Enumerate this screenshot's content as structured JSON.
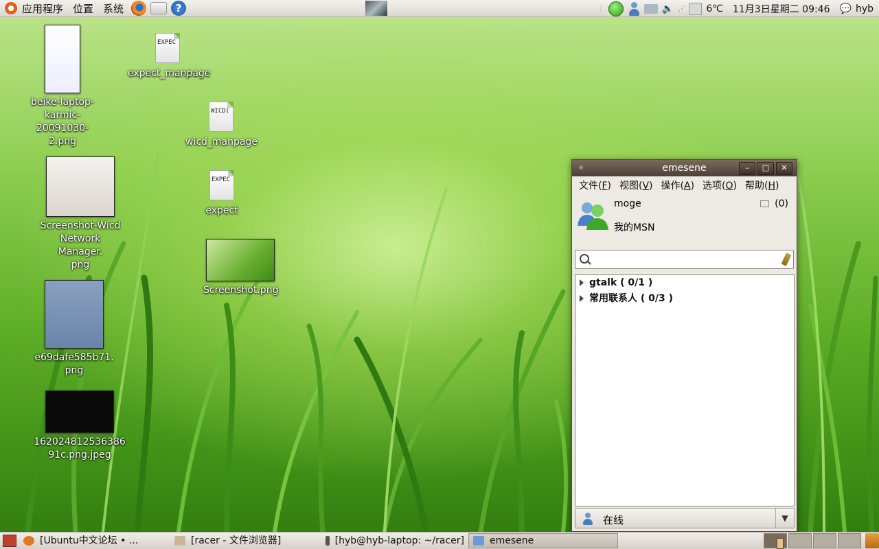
{
  "top_panel": {
    "menus": [
      "应用程序",
      "位置",
      "系统"
    ],
    "launchers": [
      "firefox-icon",
      "mail-icon",
      "help-icon"
    ],
    "tray": {
      "temperature": "6℃",
      "clock": "11月3日星期二 09:46",
      "user": "hyb"
    }
  },
  "desktop": {
    "icons": [
      {
        "name": "beike-laptop-karmic-20091030-2.png",
        "line1": "beike-laptop-",
        "line2": "karmic-20091030-",
        "line3": "2.png"
      },
      {
        "name": "expect_manpage",
        "line1": "expect_manpage",
        "badge": "EXPEC"
      },
      {
        "name": "wicd_manpage",
        "line1": "wicd_manpage",
        "badge": "WICD("
      },
      {
        "name": "expect",
        "line1": "expect",
        "badge": "EXPEC"
      },
      {
        "name": "Screenshot-Wicd Network Manager.png",
        "line1": "Screenshot-Wicd",
        "line2": "Network Manager.",
        "line3": "png"
      },
      {
        "name": "Screenshot.png",
        "line1": "Screenshot.png"
      },
      {
        "name": "e69dafe585b71.png",
        "line1": "e69dafe585b71.",
        "line2": "png"
      },
      {
        "name": "16202481253638691c.png.jpeg",
        "line1": "162024812536386",
        "line2": "91c.png.jpeg"
      }
    ]
  },
  "emesene": {
    "title": "emesene",
    "menu": [
      {
        "label": "文件(",
        "key": "F",
        "end": ")"
      },
      {
        "label": "视图(",
        "key": "V",
        "end": ")"
      },
      {
        "label": "操作(",
        "key": "A",
        "end": ")"
      },
      {
        "label": "选项(",
        "key": "O",
        "end": ")"
      },
      {
        "label": "帮助(",
        "key": "H",
        "end": ")"
      }
    ],
    "nick": "moge",
    "psm": "我的MSN",
    "mail_count": "(0)",
    "search_value": "",
    "groups": [
      {
        "label": "gtalk ( 0/1 )"
      },
      {
        "label": "常用联系人 ( 0/3 )"
      }
    ],
    "status": "在线"
  },
  "bottom_panel": {
    "tasks": [
      {
        "label": "[Ubuntu中文论坛 • ...",
        "icon": "firefox-icon",
        "color": "#e07a20"
      },
      {
        "label": "[racer - 文件浏览器]",
        "icon": "folder-icon",
        "color": "#c8b898"
      },
      {
        "label": "[hyb@hyb-laptop: ~/racer]",
        "icon": "terminal-icon",
        "color": "#555555"
      },
      {
        "label": "emesene",
        "icon": "emesene-icon",
        "color": "#6a9ad8"
      }
    ]
  }
}
